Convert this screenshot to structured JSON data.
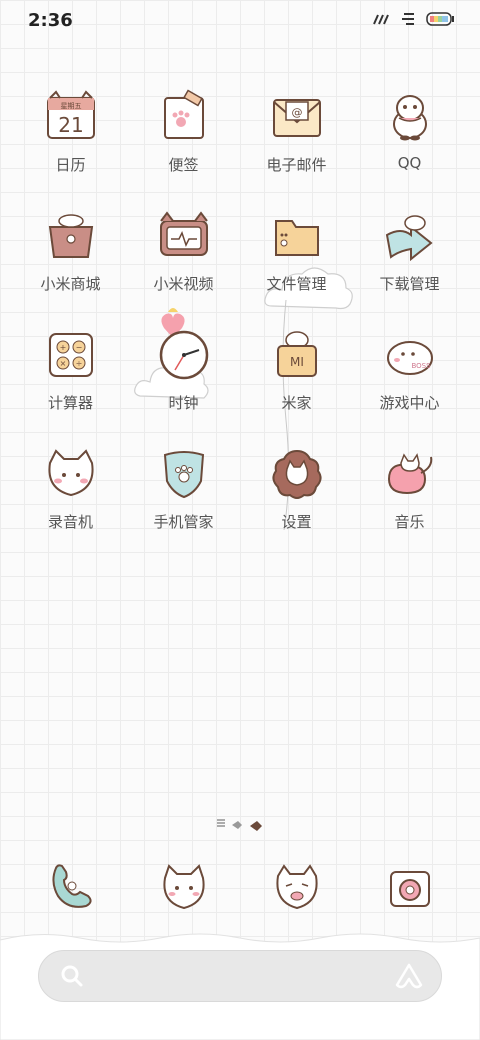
{
  "status_bar": {
    "time": "2:36"
  },
  "apps": [
    {
      "label": "日历",
      "icon": "calendar-icon",
      "calendar_top": "星期五",
      "calendar_day": "21"
    },
    {
      "label": "便签",
      "icon": "notes-icon"
    },
    {
      "label": "电子邮件",
      "icon": "email-icon"
    },
    {
      "label": "QQ",
      "icon": "qq-icon"
    },
    {
      "label": "小米商城",
      "icon": "mi-store-icon"
    },
    {
      "label": "小米视频",
      "icon": "mi-video-icon"
    },
    {
      "label": "文件管理",
      "icon": "file-manager-icon"
    },
    {
      "label": "下载管理",
      "icon": "download-manager-icon"
    },
    {
      "label": "计算器",
      "icon": "calculator-icon"
    },
    {
      "label": "时钟",
      "icon": "clock-icon"
    },
    {
      "label": "米家",
      "icon": "mijia-icon",
      "mijia_text": "MI"
    },
    {
      "label": "游戏中心",
      "icon": "game-center-icon",
      "boss_text": "BOSS"
    },
    {
      "label": "录音机",
      "icon": "recorder-icon"
    },
    {
      "label": "手机管家",
      "icon": "security-icon"
    },
    {
      "label": "设置",
      "icon": "settings-icon"
    },
    {
      "label": "音乐",
      "icon": "music-icon"
    }
  ],
  "dock": [
    {
      "icon": "phone-icon"
    },
    {
      "icon": "messages-icon"
    },
    {
      "icon": "browser-icon"
    },
    {
      "icon": "camera-icon"
    }
  ],
  "colors": {
    "icon_stroke": "#6b4a3a",
    "label": "#555555",
    "pink": "#f2a8b4",
    "teal": "#bfe3e4",
    "tan": "#f6d39a",
    "brown": "#a66a5d"
  }
}
